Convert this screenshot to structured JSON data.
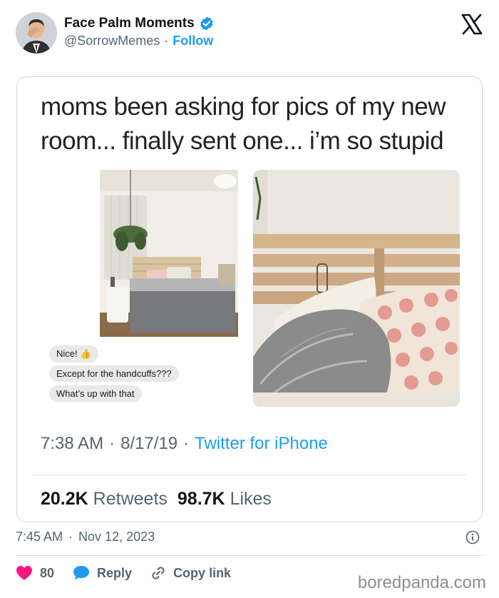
{
  "header": {
    "display_name": "Face Palm Moments",
    "handle": "@SorrowMemes",
    "separator": "·",
    "follow_label": "Follow",
    "avatar_icon": "person-facepalm-avatar",
    "verified_icon": "verified-badge-icon",
    "platform_icon": "x-logo-icon"
  },
  "embedded_tweet": {
    "text": "moms been asking for pics of my new room... finally sent one... i’m so stupid",
    "messages": [
      "Nice! 👍",
      "Except for the handcuffs???",
      "What’s up with that"
    ],
    "time": "7:38 AM",
    "date": "8/17/19",
    "separator": "·",
    "source": "Twitter for iPhone",
    "retweets_count": "20.2K",
    "retweets_label": "Retweets",
    "likes_count": "98.7K",
    "likes_label": "Likes"
  },
  "footer": {
    "time": "7:45 AM",
    "separator": "·",
    "date": "Nov 12, 2023",
    "like_count": "80",
    "reply_label": "Reply",
    "copy_link_label": "Copy link",
    "watermark": "boredpanda.com"
  },
  "colors": {
    "accent": "#1d9bf0",
    "like_heart": "#f91880",
    "text_primary": "#0f1419",
    "text_secondary": "#536471"
  }
}
